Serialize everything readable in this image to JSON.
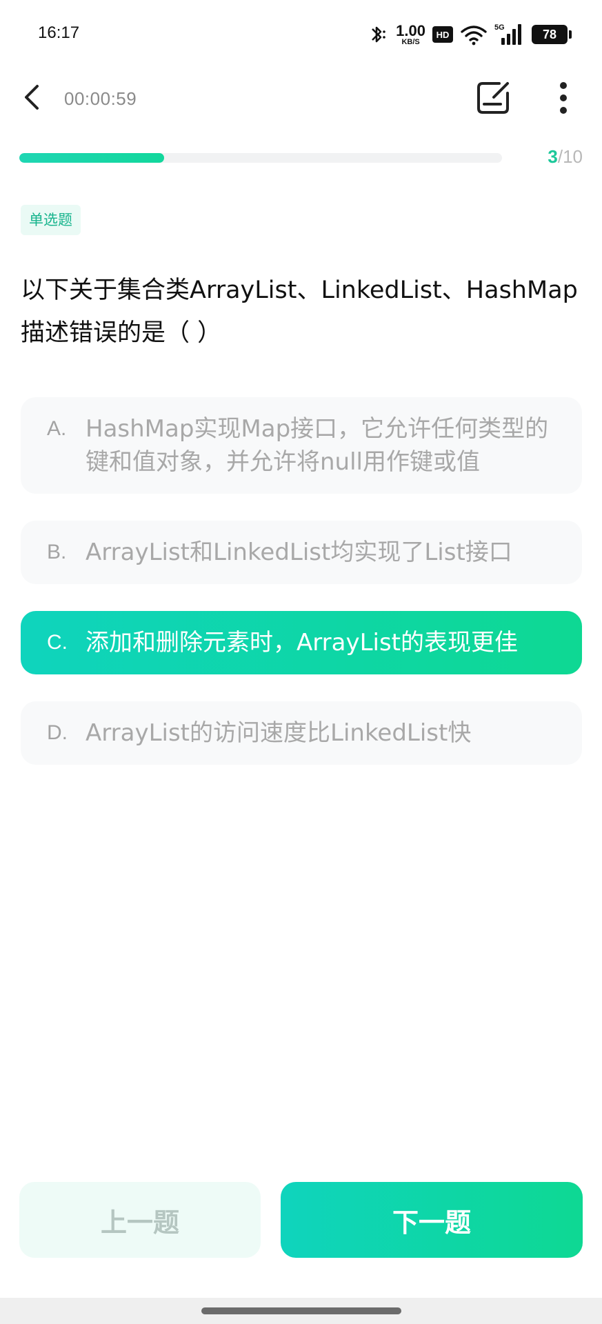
{
  "status_bar": {
    "time": "16:17",
    "net_speed_value": "1.00",
    "net_speed_unit": "KB/S",
    "hd_label": "HD",
    "network_label": "5G",
    "battery": "78",
    "icons": [
      "bluetooth-icon",
      "wifi-icon",
      "signal-icon",
      "battery-icon"
    ]
  },
  "header": {
    "timer": "00:00:59",
    "icons": [
      "back-arrow-icon",
      "note-edit-icon",
      "more-vertical-icon"
    ]
  },
  "progress": {
    "current": "3",
    "separator_total": "/10",
    "fraction": 0.3
  },
  "question": {
    "type_tag": "单选题",
    "text": "以下关于集合类ArrayList、LinkedList、HashMap\n描述错误的是（ ）"
  },
  "options": [
    {
      "letter": "A.",
      "text": "HashMap实现Map接口，它允许任何类型的键和值对象，并允许将null用作键或值",
      "selected": false
    },
    {
      "letter": "B.",
      "text": "ArrayList和LinkedList均实现了List接口",
      "selected": false
    },
    {
      "letter": "C.",
      "text": "添加和删除元素时，ArrayList的表现更佳",
      "selected": true
    },
    {
      "letter": "D.",
      "text": "ArrayList的访问速度比LinkedList快",
      "selected": false
    }
  ],
  "footer": {
    "prev_label": "上一题",
    "next_label": "下一题"
  },
  "colors": {
    "accent": "#12d6a6",
    "accent_dark": "#17b48d",
    "option_bg": "#f8f9fa",
    "prev_bg": "#eefbf7"
  }
}
